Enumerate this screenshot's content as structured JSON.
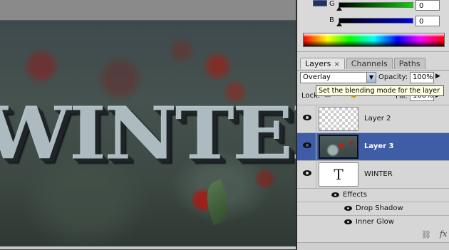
{
  "canvas": {
    "text": "WINTER"
  },
  "color_panel": {
    "swatch_color": "#20306a",
    "g": {
      "label": "G",
      "value": "0"
    },
    "b": {
      "label": "B",
      "value": "0"
    }
  },
  "tabs": [
    {
      "label": "Layers",
      "close": "×",
      "active": true
    },
    {
      "label": "Channels",
      "active": false
    },
    {
      "label": "Paths",
      "active": false
    }
  ],
  "layers_controls": {
    "blend_mode": "Overlay",
    "opacity_label": "Opacity:",
    "opacity_value": "100%",
    "lock_label": "Lock:",
    "fill_label": "Fill:",
    "fill_value": "100%",
    "tooltip": "Set the blending mode for the layer"
  },
  "layers": [
    {
      "name": "Layer 2",
      "thumb": "transparent",
      "visible": true,
      "selected": false
    },
    {
      "name": "Layer 3",
      "thumb": "photo",
      "visible": true,
      "selected": true
    },
    {
      "name": "WINTER",
      "thumb": "text",
      "thumb_glyph": "T",
      "visible": true,
      "selected": false
    }
  ],
  "effects": {
    "label": "Effects",
    "items": [
      {
        "label": "Drop Shadow"
      },
      {
        "label": "Inner Glow"
      }
    ]
  },
  "footer_icons": [
    "link-icon",
    "fx-icon"
  ],
  "colors": {
    "selection": "#3f5ca6",
    "panel_bg": "#d6d6d6",
    "tooltip_bg": "#ffffe1"
  }
}
